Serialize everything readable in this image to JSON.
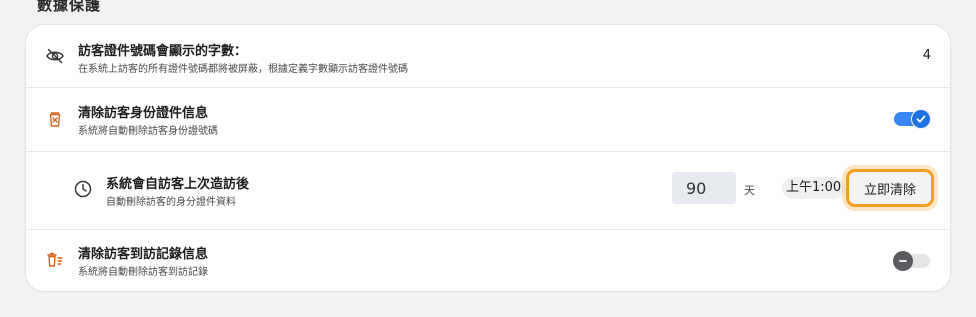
{
  "section": {
    "title": "數據保護"
  },
  "rows": [
    {
      "icon": "eye-off-icon",
      "title": "訪客證件號碼會顯示的字數：",
      "desc": "在系統上訪客的所有證件號碼都將被屏蔽，根據定義字數顯示訪客證件號碼",
      "value": "4"
    },
    {
      "icon": "trash-id-icon",
      "title": "清除訪客身份證件信息",
      "desc": "系統將自動刪除訪客身份證號碼",
      "toggle": "on"
    },
    {
      "icon": "clock-icon",
      "title": "系統會自訪客上次造訪後",
      "desc": "自動刪除訪客的身分證件資料",
      "days_value": "90",
      "days_unit": "天",
      "time": "上午1:00",
      "clear_label": "立即清除"
    },
    {
      "icon": "trash-list-icon",
      "title": "清除訪客到訪記錄信息",
      "desc": "系統將自動刪除訪客到訪記錄",
      "toggle": "off"
    }
  ],
  "colors": {
    "accent": "#3a86f5",
    "icon_orange": "#d9621a",
    "focus_ring": "#f0a020"
  }
}
